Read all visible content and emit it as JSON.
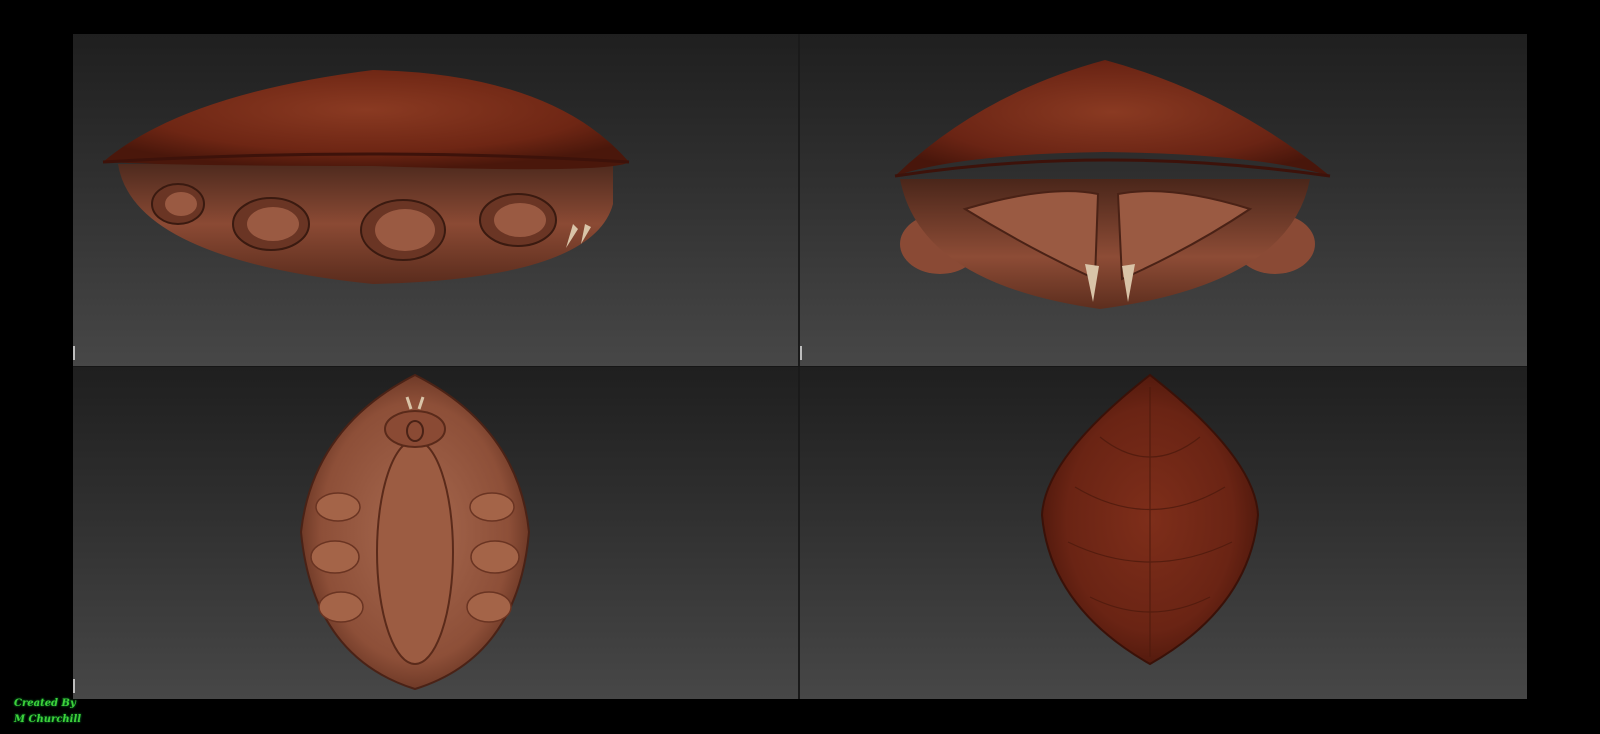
{
  "credit": {
    "line1": "Created By",
    "line2": "M Churchill"
  },
  "colors": {
    "background": "#000000",
    "viewport_top": "#1f1f1f",
    "viewport_bottom": "#474747",
    "shell": "#7a2a18",
    "skin": "#8a4a35",
    "credit_text": "#3fd13a"
  },
  "viewports": [
    {
      "view": "side",
      "subject": "creature-model"
    },
    {
      "view": "front",
      "subject": "creature-model"
    },
    {
      "view": "bottom",
      "subject": "creature-model"
    },
    {
      "view": "top",
      "subject": "creature-model"
    }
  ]
}
